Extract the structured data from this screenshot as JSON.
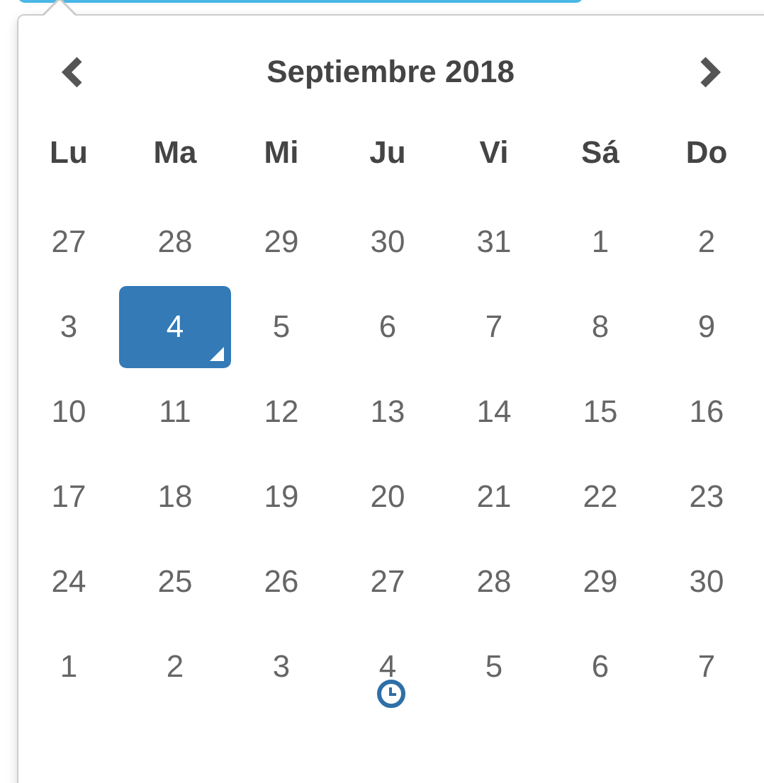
{
  "calendar": {
    "title": "Septiembre 2018",
    "weekdays": [
      "Lu",
      "Ma",
      "Mi",
      "Ju",
      "Vi",
      "Sá",
      "Do"
    ],
    "weeks": [
      [
        {
          "day": "27",
          "selected": false,
          "today": false
        },
        {
          "day": "28",
          "selected": false,
          "today": false
        },
        {
          "day": "29",
          "selected": false,
          "today": false
        },
        {
          "day": "30",
          "selected": false,
          "today": false
        },
        {
          "day": "31",
          "selected": false,
          "today": false
        },
        {
          "day": "1",
          "selected": false,
          "today": false
        },
        {
          "day": "2",
          "selected": false,
          "today": false
        }
      ],
      [
        {
          "day": "3",
          "selected": false,
          "today": false
        },
        {
          "day": "4",
          "selected": true,
          "today": true
        },
        {
          "day": "5",
          "selected": false,
          "today": false
        },
        {
          "day": "6",
          "selected": false,
          "today": false
        },
        {
          "day": "7",
          "selected": false,
          "today": false
        },
        {
          "day": "8",
          "selected": false,
          "today": false
        },
        {
          "day": "9",
          "selected": false,
          "today": false
        }
      ],
      [
        {
          "day": "10",
          "selected": false,
          "today": false
        },
        {
          "day": "11",
          "selected": false,
          "today": false
        },
        {
          "day": "12",
          "selected": false,
          "today": false
        },
        {
          "day": "13",
          "selected": false,
          "today": false
        },
        {
          "day": "14",
          "selected": false,
          "today": false
        },
        {
          "day": "15",
          "selected": false,
          "today": false
        },
        {
          "day": "16",
          "selected": false,
          "today": false
        }
      ],
      [
        {
          "day": "17",
          "selected": false,
          "today": false
        },
        {
          "day": "18",
          "selected": false,
          "today": false
        },
        {
          "day": "19",
          "selected": false,
          "today": false
        },
        {
          "day": "20",
          "selected": false,
          "today": false
        },
        {
          "day": "21",
          "selected": false,
          "today": false
        },
        {
          "day": "22",
          "selected": false,
          "today": false
        },
        {
          "day": "23",
          "selected": false,
          "today": false
        }
      ],
      [
        {
          "day": "24",
          "selected": false,
          "today": false
        },
        {
          "day": "25",
          "selected": false,
          "today": false
        },
        {
          "day": "26",
          "selected": false,
          "today": false
        },
        {
          "day": "27",
          "selected": false,
          "today": false
        },
        {
          "day": "28",
          "selected": false,
          "today": false
        },
        {
          "day": "29",
          "selected": false,
          "today": false
        },
        {
          "day": "30",
          "selected": false,
          "today": false
        }
      ],
      [
        {
          "day": "1",
          "selected": false,
          "today": false
        },
        {
          "day": "2",
          "selected": false,
          "today": false
        },
        {
          "day": "3",
          "selected": false,
          "today": false
        },
        {
          "day": "4",
          "selected": false,
          "today": false
        },
        {
          "day": "5",
          "selected": false,
          "today": false
        },
        {
          "day": "6",
          "selected": false,
          "today": false
        },
        {
          "day": "7",
          "selected": false,
          "today": false
        }
      ]
    ]
  }
}
